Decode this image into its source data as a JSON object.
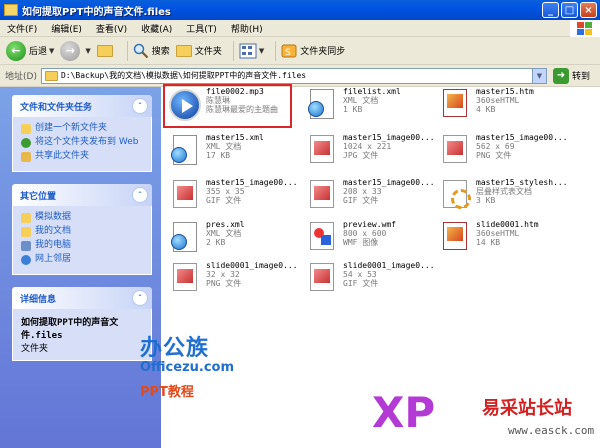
{
  "window": {
    "title": "如何提取PPT中的声音文件.files",
    "buttons": [
      "_",
      "□",
      "×"
    ]
  },
  "menu": {
    "items": [
      "文件(F)",
      "编辑(E)",
      "查看(V)",
      "收藏(A)",
      "工具(T)",
      "帮助(H)"
    ]
  },
  "toolbar": {
    "back": "后退",
    "search": "搜索",
    "folders": "文件夹",
    "sync": "文件夹同步"
  },
  "address": {
    "label": "地址(D)",
    "value": "D:\\Backup\\我的文档\\模拟数据\\如何提取PPT中的声音文件.files",
    "go": "转到"
  },
  "sidebar": {
    "tasks": {
      "title": "文件和文件夹任务",
      "items": [
        "创建一个新文件夹",
        "将这个文件夹发布到 Web",
        "共享此文件夹"
      ]
    },
    "places": {
      "title": "其它位置",
      "items": [
        "模拟数据",
        "我的文档",
        "我的电脑",
        "网上邻居"
      ]
    },
    "details": {
      "title": "详细信息",
      "name": "如何提取PPT中的声音文件.files",
      "type": "文件夹"
    }
  },
  "files": [
    {
      "name": "file0002.mp3",
      "l2": "陈慧琳",
      "l3": "陈慧琳最爱的主题曲",
      "icon": "media-icon"
    },
    {
      "name": "filelist.xml",
      "l2": "XML 文档",
      "l3": "1 KB",
      "icon": "xml-icon"
    },
    {
      "name": "master15.htm",
      "l2": "360seHTML",
      "l3": "4 KB",
      "icon": "html-icon"
    },
    {
      "name": "master15.xml",
      "l2": "XML 文档",
      "l3": "17 KB",
      "icon": "xml-icon"
    },
    {
      "name": "master15_image00...",
      "l2": "1024 x 221",
      "l3": "JPG 文件",
      "icon": "image-icon"
    },
    {
      "name": "master15_image00...",
      "l2": "562 x 69",
      "l3": "PNG 文件",
      "icon": "image-icon"
    },
    {
      "name": "master15_image00...",
      "l2": "355 x 35",
      "l3": "GIF 文件",
      "icon": "image-icon"
    },
    {
      "name": "master15_image00...",
      "l2": "208 x 33",
      "l3": "GIF 文件",
      "icon": "image-icon"
    },
    {
      "name": "master15_stylesh...",
      "l2": "层叠样式表文档",
      "l3": "3 KB",
      "icon": "css-icon"
    },
    {
      "name": "pres.xml",
      "l2": "XML 文档",
      "l3": "2 KB",
      "icon": "xml-icon"
    },
    {
      "name": "preview.wmf",
      "l2": "800 x 600",
      "l3": "WMF 图像",
      "icon": "wmf-icon"
    },
    {
      "name": "slide0001.htm",
      "l2": "360seHTML",
      "l3": "14 KB",
      "icon": "html-icon"
    },
    {
      "name": "slide0001_image0...",
      "l2": "32 x 32",
      "l3": "PNG 文件",
      "icon": "image-icon"
    },
    {
      "name": "slide0001_image0...",
      "l2": "54 x 53",
      "l3": "GIF 文件",
      "icon": "image-icon"
    }
  ],
  "watermarks": {
    "line1": "办公族",
    "line2": "Officezu.com",
    "line3": "PPT教程",
    "xp": "XP",
    "brand": "易采站长站",
    "url": "www.easck.com"
  }
}
